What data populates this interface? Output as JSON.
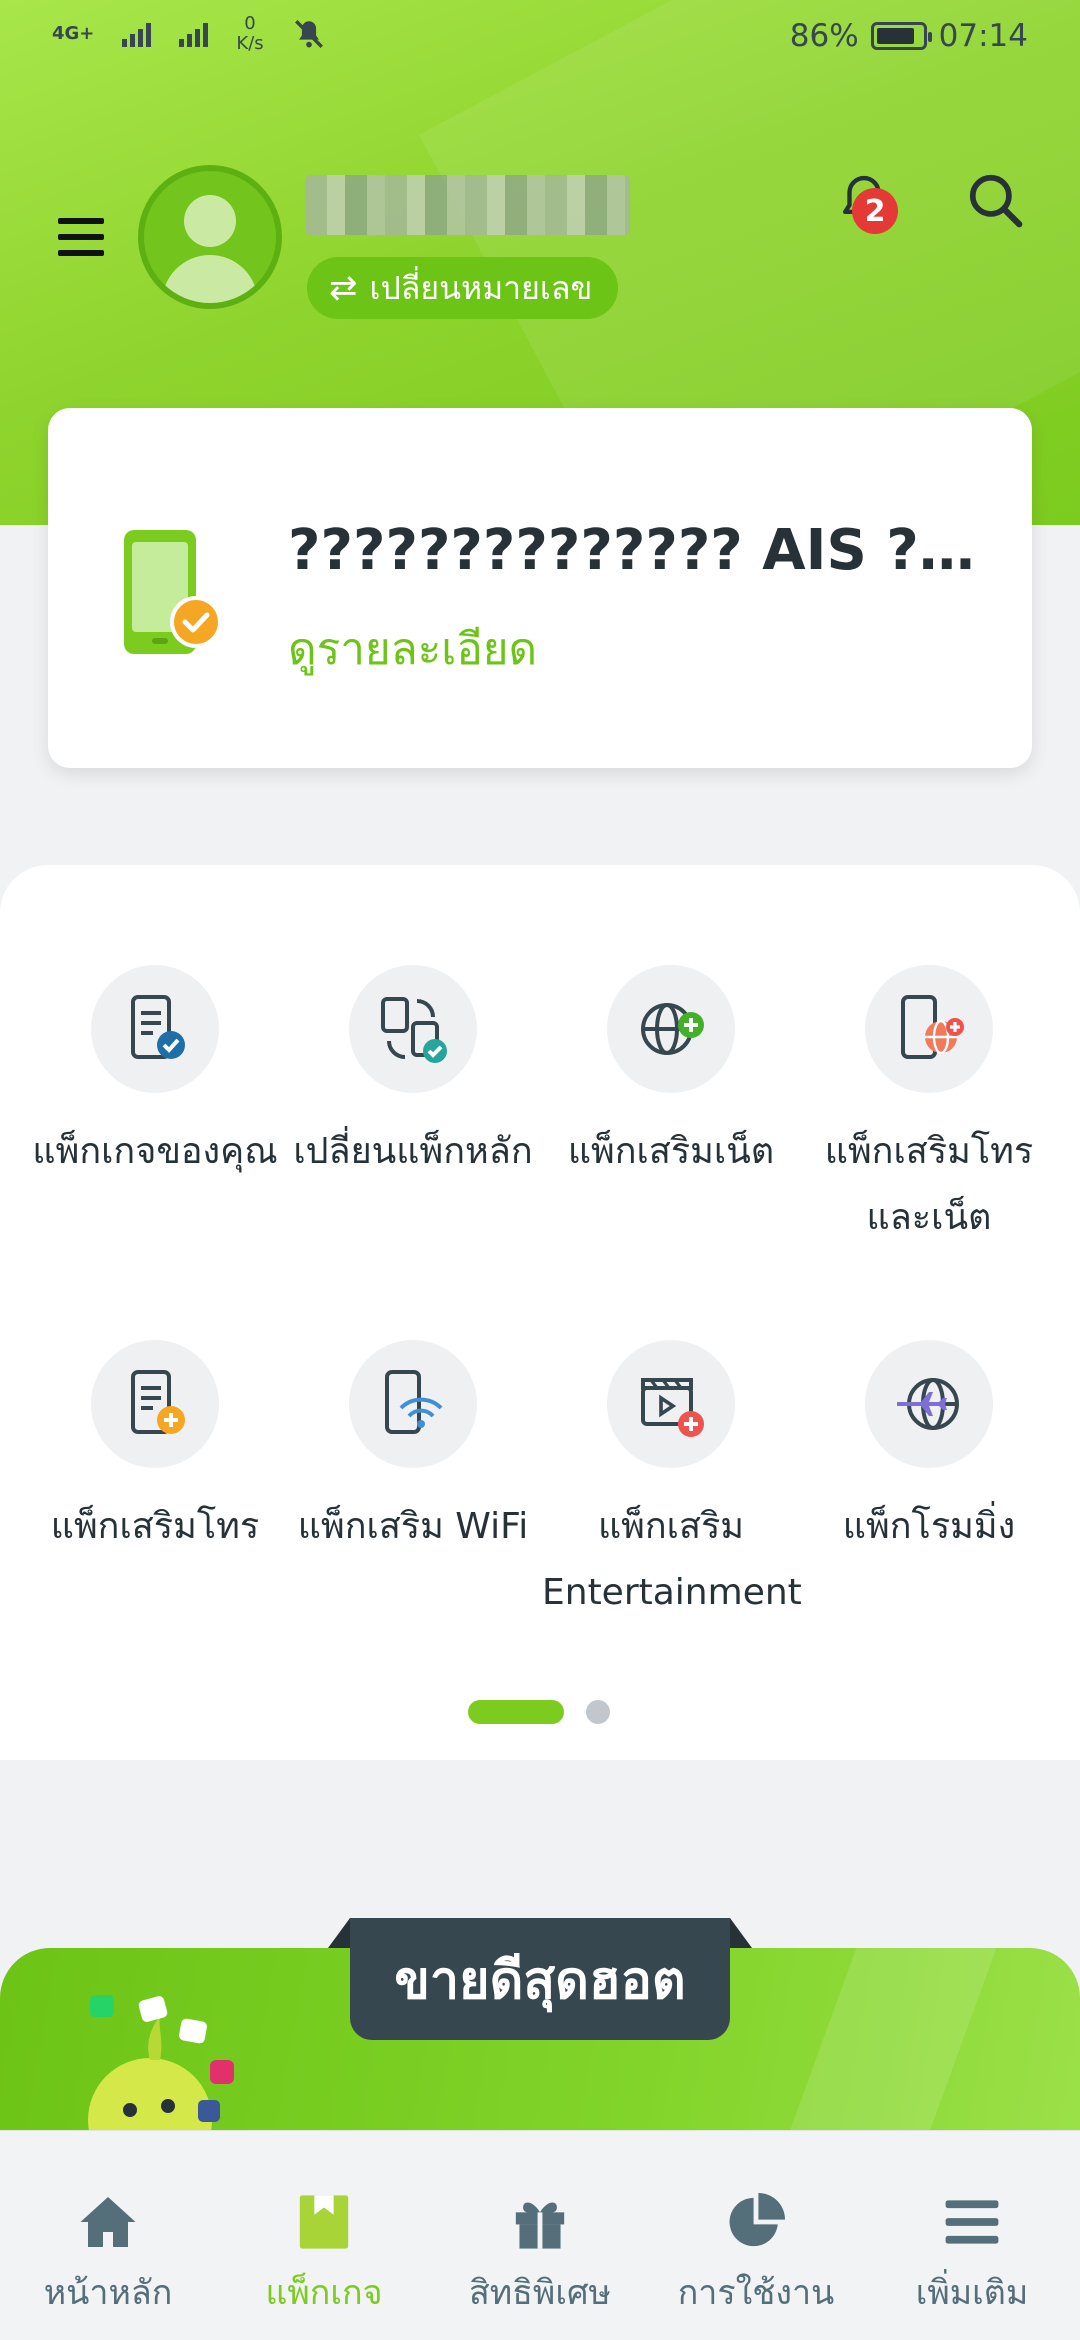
{
  "status_bar": {
    "network": "4G+",
    "speed_value": "0",
    "speed_unit": "K/s",
    "battery": "86%",
    "battery_level": 0.86,
    "time": "07:14"
  },
  "header": {
    "change_number_label": "เปลี่ยนหมายเลข",
    "notification_count": "2"
  },
  "sim_card": {
    "title": "?????????????? AIS ???...",
    "details_link": "ดูรายละเอียด"
  },
  "menu_grid": {
    "items": [
      {
        "label": "แพ็กเกจของคุณ",
        "icon": "your-package-icon"
      },
      {
        "label": "เปลี่ยนแพ็กหลัก",
        "icon": "change-main-package-icon"
      },
      {
        "label": "แพ็กเสริมเน็ต",
        "icon": "internet-addon-icon"
      },
      {
        "label": "แพ็กเสริมโทรและเน็ต",
        "icon": "call-and-net-addon-icon"
      },
      {
        "label": "แพ็กเสริมโทร",
        "icon": "call-addon-icon"
      },
      {
        "label": "แพ็กเสริม WiFi",
        "icon": "wifi-addon-icon"
      },
      {
        "label": "แพ็กเสริม Entertainment",
        "icon": "entertainment-addon-icon"
      },
      {
        "label": "แพ็กโรมมิ่ง",
        "icon": "roaming-icon"
      }
    ],
    "page_indicator": {
      "current": 1,
      "total": 2
    }
  },
  "promo": {
    "title": "ขายดีสุดฮอต"
  },
  "bottom_nav": {
    "items": [
      {
        "label": "หน้าหลัก",
        "icon": "home-icon"
      },
      {
        "label": "แพ็กเกจ",
        "icon": "package-icon"
      },
      {
        "label": "สิทธิพิเศษ",
        "icon": "gift-icon"
      },
      {
        "label": "การใช้งาน",
        "icon": "usage-pie-icon"
      },
      {
        "label": "เพิ่มเติม",
        "icon": "more-menu-icon"
      }
    ],
    "active_index": 1
  },
  "colors": {
    "brand_green": "#7ccb1f",
    "dark": "#37474f",
    "badge_red": "#e53935"
  }
}
